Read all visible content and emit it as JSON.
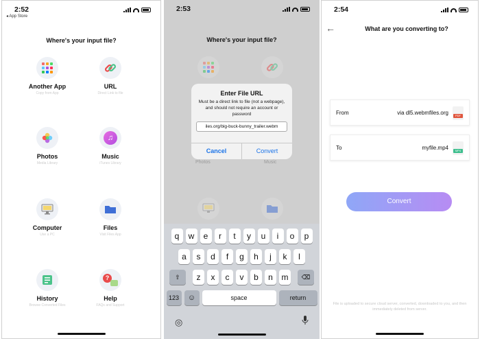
{
  "screen1": {
    "time": "2:52",
    "back_app": "◂ App Store",
    "title": "Where's your input file?",
    "tiles": [
      {
        "label": "Another App",
        "sub": "Copy from App"
      },
      {
        "label": "URL",
        "sub": "Direct Link to file"
      },
      {
        "label": "Photos",
        "sub": "Media Library"
      },
      {
        "label": "Music",
        "sub": "iTunes Library"
      },
      {
        "label": "Computer",
        "sub": "Use a PC"
      },
      {
        "label": "Files",
        "sub": "Visit Files App"
      },
      {
        "label": "History",
        "sub": "Browse Converted Files"
      },
      {
        "label": "Help",
        "sub": "FAQs and Support"
      }
    ]
  },
  "screen2": {
    "time": "2:53",
    "title": "Where's your input file?",
    "dialog": {
      "title": "Enter File URL",
      "message": "Must be a direct link to file (not a webpage), and should not require an account or password",
      "field_value": "iles.org/big-buck-bunny_trailer.webm",
      "cancel": "Cancel",
      "convert": "Convert"
    },
    "behind_labels": [
      "Photos",
      "Music"
    ],
    "keyboard": {
      "row1": [
        "q",
        "w",
        "e",
        "r",
        "t",
        "y",
        "u",
        "i",
        "o",
        "p"
      ],
      "row2": [
        "a",
        "s",
        "d",
        "f",
        "g",
        "h",
        "j",
        "k",
        "l"
      ],
      "row3": [
        "z",
        "x",
        "c",
        "v",
        "b",
        "n",
        "m"
      ],
      "num": "123",
      "space": "space",
      "return": "return"
    }
  },
  "screen3": {
    "time": "2:54",
    "title": "What are you converting to?",
    "from_label": "From",
    "from_value": "via dl5.webmfiles.org",
    "from_ext": "PDF",
    "to_label": "To",
    "to_value": "myfile.mp4",
    "to_ext": "MP4",
    "convert_button": "Convert",
    "footer": "File is uploaded to secure cloud server, converted, downloaded to you, and then immediately deleted from server."
  },
  "colors": {
    "accent_blue": "#1a73e8",
    "convert_gradient_start": "#8fa7f7",
    "convert_gradient_end": "#b78cf3"
  }
}
